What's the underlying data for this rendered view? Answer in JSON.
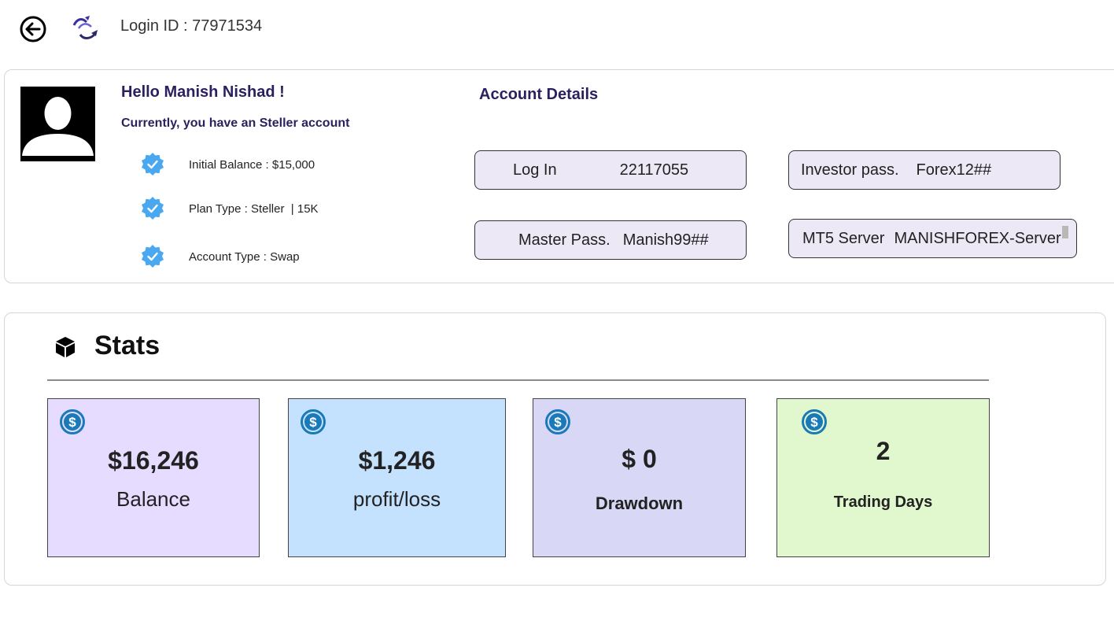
{
  "header": {
    "login_id_label": "Login ID : 77971534"
  },
  "profile": {
    "greeting": "Hello Manish Nishad !",
    "account_line": "Currently, you have an Steller account",
    "items": [
      {
        "text": "Initial Balance : $15,000",
        "icon": "verified-badge-icon"
      },
      {
        "text": "Plan Type : Steller  | 15K",
        "icon": "verified-badge-icon"
      },
      {
        "text": "Account Type : Swap",
        "icon": "verified-badge-icon"
      }
    ]
  },
  "account_details": {
    "title": "Account Details",
    "login": {
      "label": "Log In",
      "value": "22117055"
    },
    "investor": {
      "label": "Investor pass.",
      "value": "Forex12##"
    },
    "master": {
      "label": "Master Pass.",
      "value": "Manish99##"
    },
    "server": {
      "label": "MT5 Server",
      "value": "MANISHFOREX-Server"
    }
  },
  "stats": {
    "title": "Stats",
    "cards": [
      {
        "value": "$16,246",
        "label": "Balance",
        "color": "#e6dcff"
      },
      {
        "value": "$1,246",
        "label": "profit/loss",
        "color": "#c4e1fd"
      },
      {
        "value": "$ 0",
        "label": "Drawdown",
        "color": "#d8d8f6"
      },
      {
        "value": "2",
        "label": "Trading Days",
        "color": "#e1f7cd"
      }
    ]
  },
  "colors": {
    "heading": "#2c1f5e",
    "field_bg": "#ece8f6",
    "badge_blue": "#4aa8f0",
    "dollar_blue": "#1a7ab8"
  }
}
